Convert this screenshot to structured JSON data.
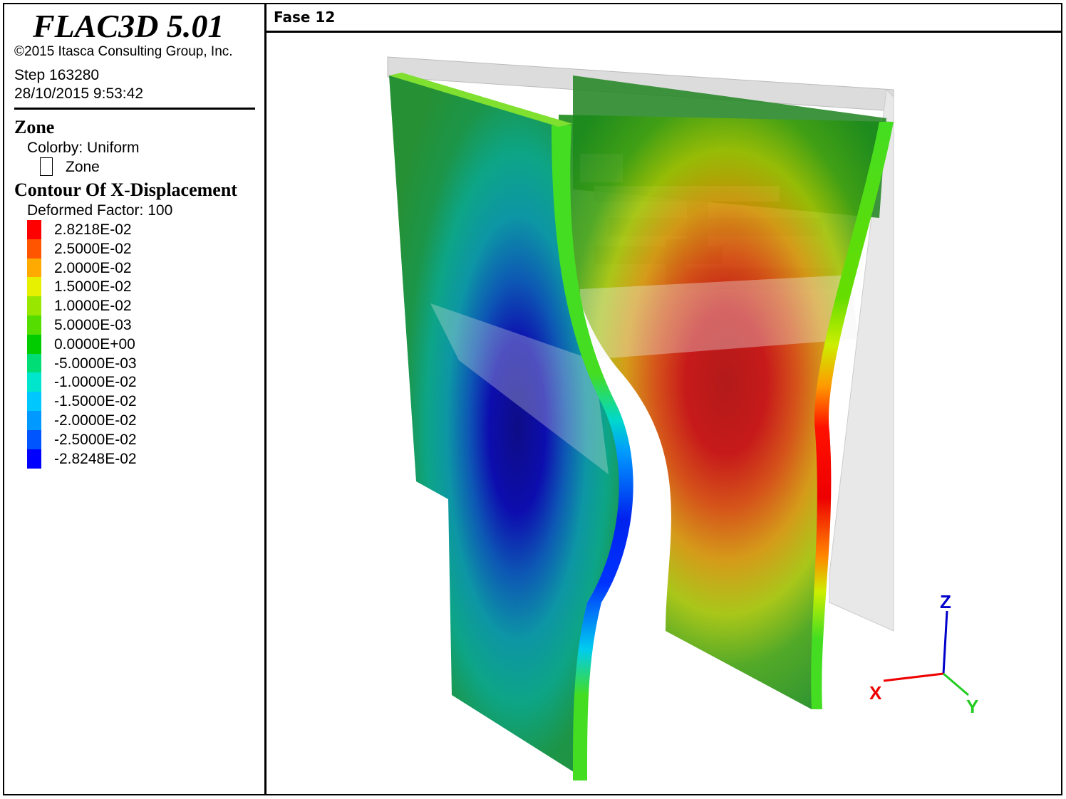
{
  "app": {
    "title": "FLAC3D 5.01",
    "copyright": "©2015 Itasca Consulting Group, Inc.",
    "step": "Step 163280",
    "datetime": "28/10/2015 9:53:42"
  },
  "legend": {
    "zone_title": "Zone",
    "colorby": "Colorby: Uniform",
    "zone_item": "Zone",
    "contour_title": "Contour Of X-Displacement",
    "deformed_factor": "Deformed Factor: 100",
    "scale": [
      {
        "label": "2.8218E-02",
        "color": "#ff0000"
      },
      {
        "label": "2.5000E-02",
        "color": "#ff5500"
      },
      {
        "label": "2.0000E-02",
        "color": "#ffaa00"
      },
      {
        "label": "1.5000E-02",
        "color": "#e6f000"
      },
      {
        "label": "1.0000E-02",
        "color": "#99e600"
      },
      {
        "label": "5.0000E-03",
        "color": "#55dd00"
      },
      {
        "label": "0.0000E+00",
        "color": "#00cc00"
      },
      {
        "label": "-5.0000E-03",
        "color": "#00dd77"
      },
      {
        "label": "-1.0000E-02",
        "color": "#00e6cc"
      },
      {
        "label": "-1.5000E-02",
        "color": "#00c8ff"
      },
      {
        "label": "-2.0000E-02",
        "color": "#0099ff"
      },
      {
        "label": "-2.5000E-02",
        "color": "#0055ff"
      },
      {
        "label": "-2.8248E-02",
        "color": "#0000ff"
      }
    ]
  },
  "view": {
    "title": "Fase 12",
    "axes": {
      "z": "Z",
      "x": "X",
      "y": "Y"
    },
    "axis_colors": {
      "z": "#0000cc",
      "x": "#ee0000",
      "y": "#22cc22"
    }
  }
}
